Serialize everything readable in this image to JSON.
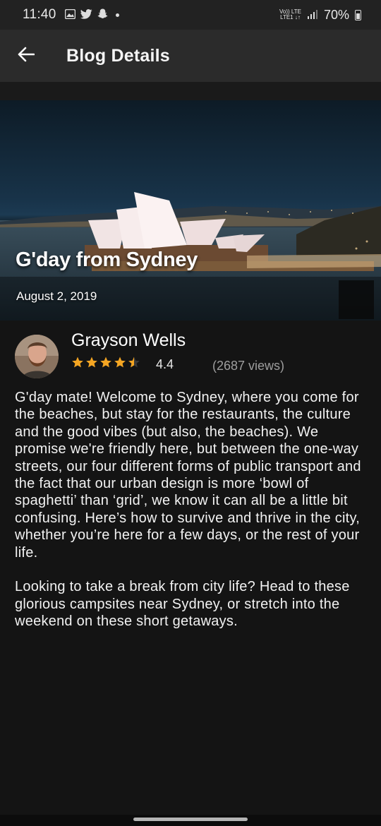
{
  "status_bar": {
    "time": "11:40",
    "carrier_top": "Vo)) LTE",
    "carrier_bottom": "LTE1 ↓↑",
    "battery": "70%"
  },
  "app_bar": {
    "title": "Blog Details",
    "back_icon": "arrow-left-icon"
  },
  "hero": {
    "title": "G'day from Sydney",
    "date": "August 2, 2019"
  },
  "author": {
    "name": "Grayson Wells",
    "rating_value": 4.4,
    "rating_label": "4.4",
    "views": "(2687 views)",
    "star_color": "#f5a623"
  },
  "article": {
    "paragraphs": [
      "G'day mate! Welcome to Sydney, where you come for the beaches, but stay for the restaurants, the culture and the good vibes (but also, the beaches). We promise we're friendly here, but between the one-way streets, our four different forms of public transport and the fact that our urban design is more ‘bowl of spaghetti’ than ‘grid’, we know it can all be a little bit confusing. Here’s how to survive and thrive in the city, whether you’re here for a few days, or the rest of your life.",
      "Looking to take a break from city life? Head to these glorious campsites near Sydney, or stretch into the weekend on these short getaways."
    ]
  }
}
